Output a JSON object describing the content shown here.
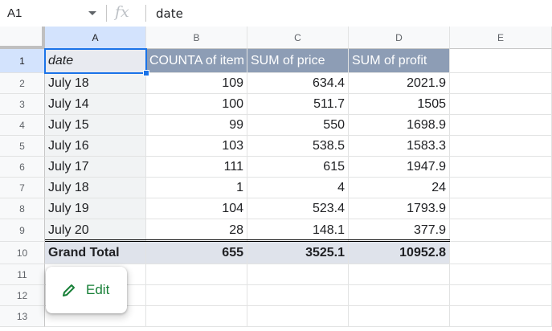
{
  "formula_bar": {
    "cell_ref": "A1",
    "fx_symbol": "fx",
    "value": "date"
  },
  "columns": [
    "A",
    "B",
    "C",
    "D",
    "E"
  ],
  "rows": [
    "1",
    "2",
    "3",
    "4",
    "5",
    "6",
    "7",
    "8",
    "9",
    "10",
    "11",
    "12",
    "13"
  ],
  "pivot": {
    "headers": [
      "date",
      "COUNTA of item",
      "SUM of price",
      "SUM of profit"
    ],
    "data": [
      [
        "July 18",
        "109",
        "634.4",
        "2021.9"
      ],
      [
        "July 14",
        "100",
        "511.7",
        "1505"
      ],
      [
        "July 15",
        "99",
        "550",
        "1698.9"
      ],
      [
        "July 16",
        "103",
        "538.5",
        "1583.3"
      ],
      [
        "July 17",
        "111",
        "615",
        "1947.9"
      ],
      [
        "July 18",
        "1",
        "4",
        "24"
      ],
      [
        "July 19",
        "104",
        "523.4",
        "1793.9"
      ],
      [
        "July 20",
        "28",
        "148.1",
        "377.9"
      ]
    ],
    "total": [
      "Grand Total",
      "655",
      "3525.1",
      "10952.8"
    ]
  },
  "edit_chip": {
    "label": "Edit",
    "icon": "pencil-icon",
    "color": "#188038"
  },
  "colors": {
    "header_bg": "#8d9db5",
    "total_bg": "#dfe3eb",
    "selection": "#1a73e8"
  }
}
